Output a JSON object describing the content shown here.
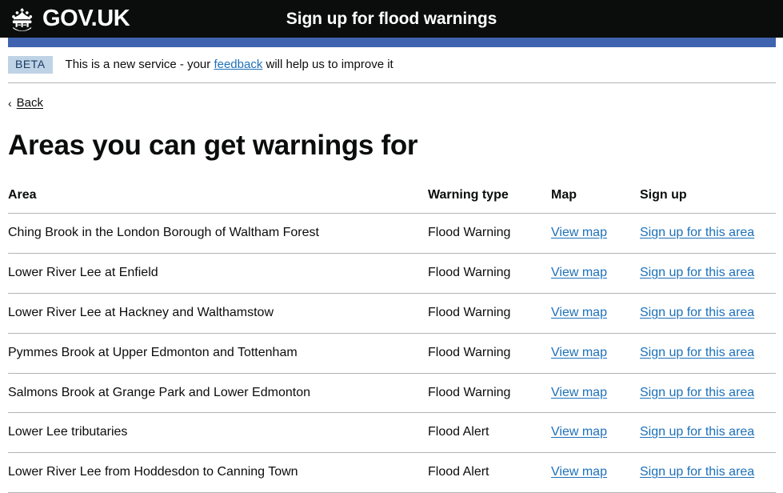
{
  "header": {
    "logo_text": "GOV.UK",
    "crown_icon": "crown-icon",
    "service_name": "Sign up for flood warnings"
  },
  "phase_banner": {
    "tag": "BETA",
    "text_before": "This is a new service - your",
    "link": "feedback",
    "text_after": "will help us to improve it"
  },
  "back_link": {
    "chevron": "‹",
    "label": "Back"
  },
  "page_title": "Areas you can get warnings for",
  "table": {
    "columns": [
      "Area",
      "Warning type",
      "Map",
      "Sign up"
    ],
    "rows": [
      {
        "area": "Ching Brook in the London Borough of Waltham Forest",
        "warning_type": "Flood Warning",
        "map_link": "View map",
        "signup_link": "Sign up for this area"
      },
      {
        "area": "Lower River Lee at Enfield",
        "warning_type": "Flood Warning",
        "map_link": "View map",
        "signup_link": "Sign up for this area"
      },
      {
        "area": "Lower River Lee at Hackney and Walthamstow",
        "warning_type": "Flood Warning",
        "map_link": "View map",
        "signup_link": "Sign up for this area"
      },
      {
        "area": "Pymmes Brook at Upper Edmonton and Tottenham",
        "warning_type": "Flood Warning",
        "map_link": "View map",
        "signup_link": "Sign up for this area"
      },
      {
        "area": "Salmons Brook at Grange Park and Lower Edmonton",
        "warning_type": "Flood Warning",
        "map_link": "View map",
        "signup_link": "Sign up for this area"
      },
      {
        "area": "Lower Lee tributaries",
        "warning_type": "Flood Alert",
        "map_link": "View map",
        "signup_link": "Sign up for this area"
      },
      {
        "area": "Lower River Lee from Hoddesdon to Canning Town",
        "warning_type": "Flood Alert",
        "map_link": "View map",
        "signup_link": "Sign up for this area"
      }
    ]
  },
  "colors": {
    "header_bg": "#0b0c0c",
    "nav_blue": "#3f63ae",
    "link_blue": "#1d70b8",
    "beta_badge_bg": "#bfd3e6",
    "border_grey": "#b1b4b6"
  }
}
